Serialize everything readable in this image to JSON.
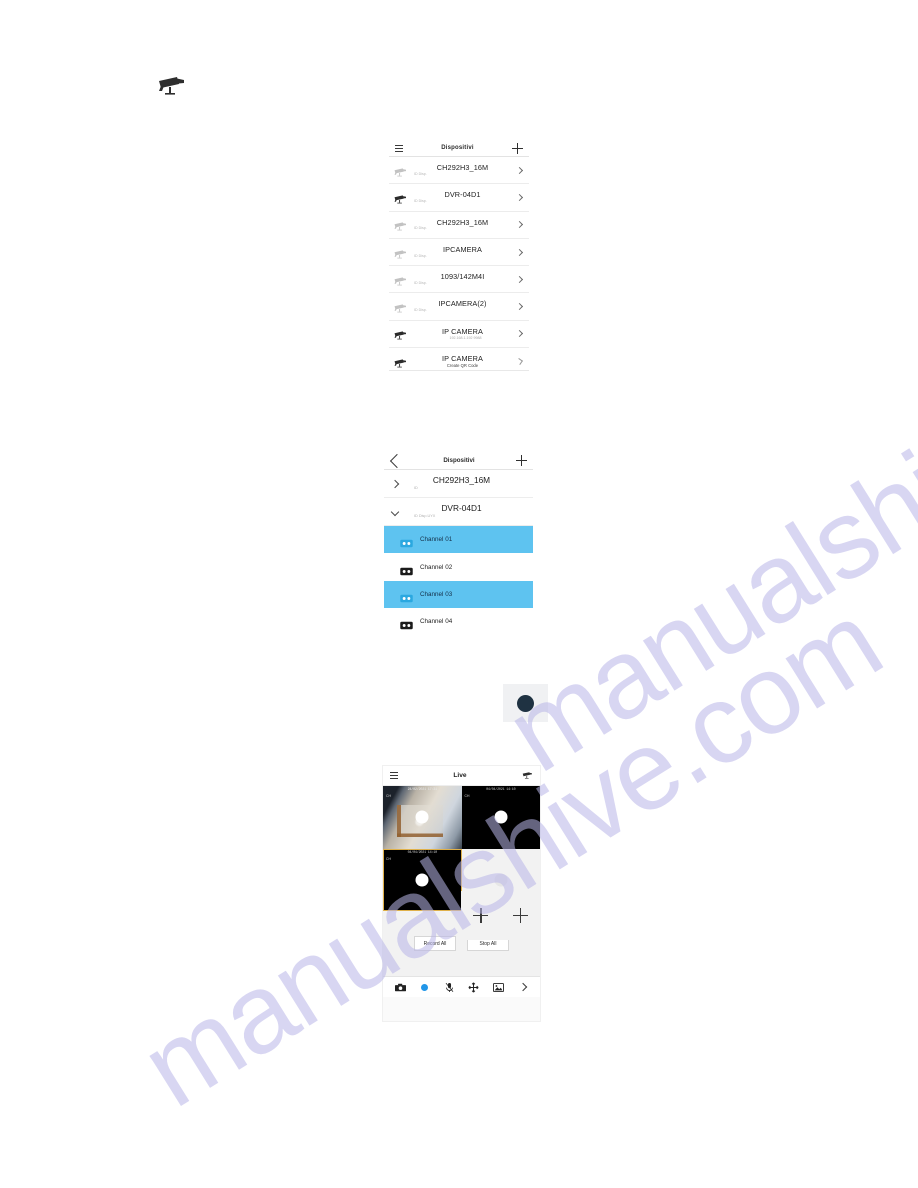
{
  "page": {
    "header_icon": "cctv-camera-icon",
    "watermark": "manualshive.com"
  },
  "screen_devices": {
    "title": "Dispositivi",
    "menu_icon": "hamburger-menu-icon",
    "add_icon": "plus-icon",
    "items": [
      {
        "name": "CH292H3_16M",
        "subtitle": "ID Disp.",
        "icon": "cctv-camera-icon",
        "chevron": "chevron-right-icon"
      },
      {
        "name": "DVR-04D1",
        "subtitle": "ID Disp.",
        "icon": "cctv-camera-icon",
        "chevron": "chevron-right-icon"
      },
      {
        "name": "CH292H3_16M",
        "subtitle": "ID Disp.",
        "icon": "cctv-camera-icon",
        "chevron": "chevron-right-icon"
      },
      {
        "name": "IPCAMERA",
        "subtitle": "ID Disp.",
        "icon": "cctv-camera-icon",
        "chevron": "chevron-right-icon"
      },
      {
        "name": "1093/142M4I",
        "subtitle": "ID Disp.",
        "icon": "cctv-camera-icon",
        "chevron": "chevron-right-icon"
      },
      {
        "name": "IPCAMERA(2)",
        "subtitle": "ID Disp.",
        "icon": "cctv-camera-icon",
        "chevron": "chevron-right-icon"
      },
      {
        "name": "IP CAMERA",
        "subtitle": "192.168.1.192  9988",
        "icon": "cctv-camera-icon",
        "chevron": "chevron-right-icon"
      },
      {
        "name": "IP CAMERA",
        "subtitle": "Create QR Code",
        "icon": "cctv-camera-icon",
        "chevron": "chevron-right-icon"
      }
    ]
  },
  "screen_channels": {
    "title": "Dispositivi",
    "back_icon": "chevron-left-icon",
    "add_icon": "plus-icon",
    "groups": [
      {
        "name": "CH292H3_16M",
        "subtitle": "ID",
        "expanded": false,
        "chevron": "chevron-right-icon"
      },
      {
        "name": "DVR-04D1",
        "subtitle": "ID Disp.UYX",
        "expanded": true,
        "chevron": "chevron-down-icon"
      }
    ],
    "channels": [
      {
        "label": "Channel 01",
        "selected": true,
        "icon": "video-channel-icon"
      },
      {
        "label": "Channel 02",
        "selected": false,
        "icon": "video-channel-icon"
      },
      {
        "label": "Channel 03",
        "selected": true,
        "icon": "video-channel-icon"
      },
      {
        "label": "Channel 04",
        "selected": false,
        "icon": "video-channel-icon"
      }
    ],
    "selected_color": "#5ec3f0"
  },
  "dot_button": {
    "icon": "record-dot-icon",
    "color": "#1f3242"
  },
  "screen_live": {
    "title": "Live",
    "menu_icon": "hamburger-menu-icon",
    "device_icon": "cctv-camera-icon",
    "cells": [
      {
        "type": "video",
        "timestamp": "24/02/2021 17:31",
        "corner_icon": "channel-badge-icon",
        "selected": false
      },
      {
        "type": "black",
        "timestamp": "04/04/2021 14:10",
        "corner_icon": "channel-badge-icon",
        "selected": false
      },
      {
        "type": "black",
        "timestamp": "04/04/2021 14:10",
        "corner_icon": "channel-badge-icon",
        "selected": true
      },
      {
        "type": "blank",
        "timestamp": "",
        "corner_icon": "",
        "selected": false
      }
    ],
    "empty_slots": [
      {
        "icon": "plus-icon"
      },
      {
        "icon": "plus-icon"
      }
    ],
    "record_all_label": "Record All",
    "stop_all_label": "Stop All",
    "toolbar": [
      {
        "icon": "snapshot-camera-icon"
      },
      {
        "icon": "record-dot-icon",
        "color": "#2196e8"
      },
      {
        "icon": "microphone-muted-icon"
      },
      {
        "icon": "pan-move-icon"
      },
      {
        "icon": "gallery-image-icon"
      },
      {
        "icon": "chevron-right-icon"
      }
    ]
  }
}
